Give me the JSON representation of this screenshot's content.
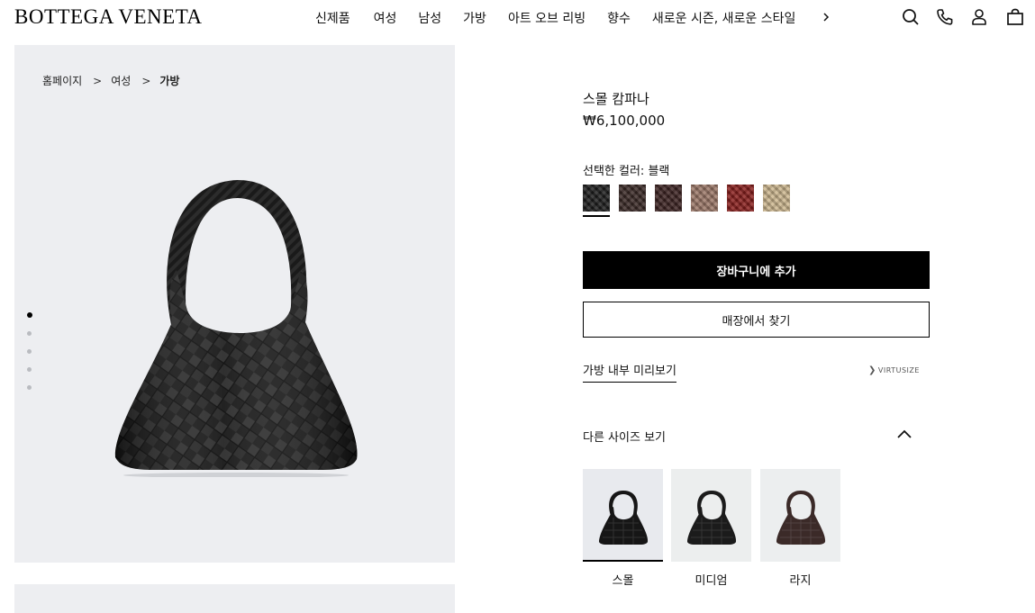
{
  "header": {
    "logo": "BOTTEGA VENETA",
    "nav": [
      "신제품",
      "여성",
      "남성",
      "가방",
      "아트 오브 리빙",
      "향수",
      "새로운 시즌, 새로운 스타일"
    ],
    "icons": [
      "chevron-right-icon",
      "search-icon",
      "phone-icon",
      "account-icon",
      "bag-icon"
    ]
  },
  "breadcrumb": [
    "홈페이지",
    "여성",
    "가방"
  ],
  "breadcrumb_separator": ">",
  "gallery": {
    "slides": 5,
    "active": 1
  },
  "product": {
    "name": "스몰 캄파나",
    "price": "₩6,100,000",
    "color_label": "선택한 컬러: 블랙",
    "colors": [
      {
        "name": "블랙",
        "hex": "#1d1d1d",
        "selected": true
      },
      {
        "name": "브라운",
        "hex": "#3a2926",
        "selected": false
      },
      {
        "name": "다크 브라운",
        "hex": "#3d2322",
        "selected": false
      },
      {
        "name": "토프",
        "hex": "#9c7868",
        "selected": false
      },
      {
        "name": "레드",
        "hex": "#8a1f1d",
        "selected": false
      },
      {
        "name": "베이지",
        "hex": "#cdb78f",
        "selected": false
      }
    ]
  },
  "actions": {
    "add_to_cart": "장바구니에 추가",
    "find_store": "매장에서 찾기",
    "preview_inside": "가방 내부 미리보기",
    "virtusize": "VIRTUSIZE"
  },
  "sizes": {
    "title": "다른 사이즈 보기",
    "items": [
      {
        "label": "스몰",
        "selected": true,
        "bg": "#e8eaee",
        "bag": "#161616"
      },
      {
        "label": "미디엄",
        "selected": false,
        "bg": "#eceeee",
        "bag": "#1b1b1b"
      },
      {
        "label": "라지",
        "selected": false,
        "bg": "#eceeef",
        "bag": "#3b2a28"
      }
    ]
  }
}
